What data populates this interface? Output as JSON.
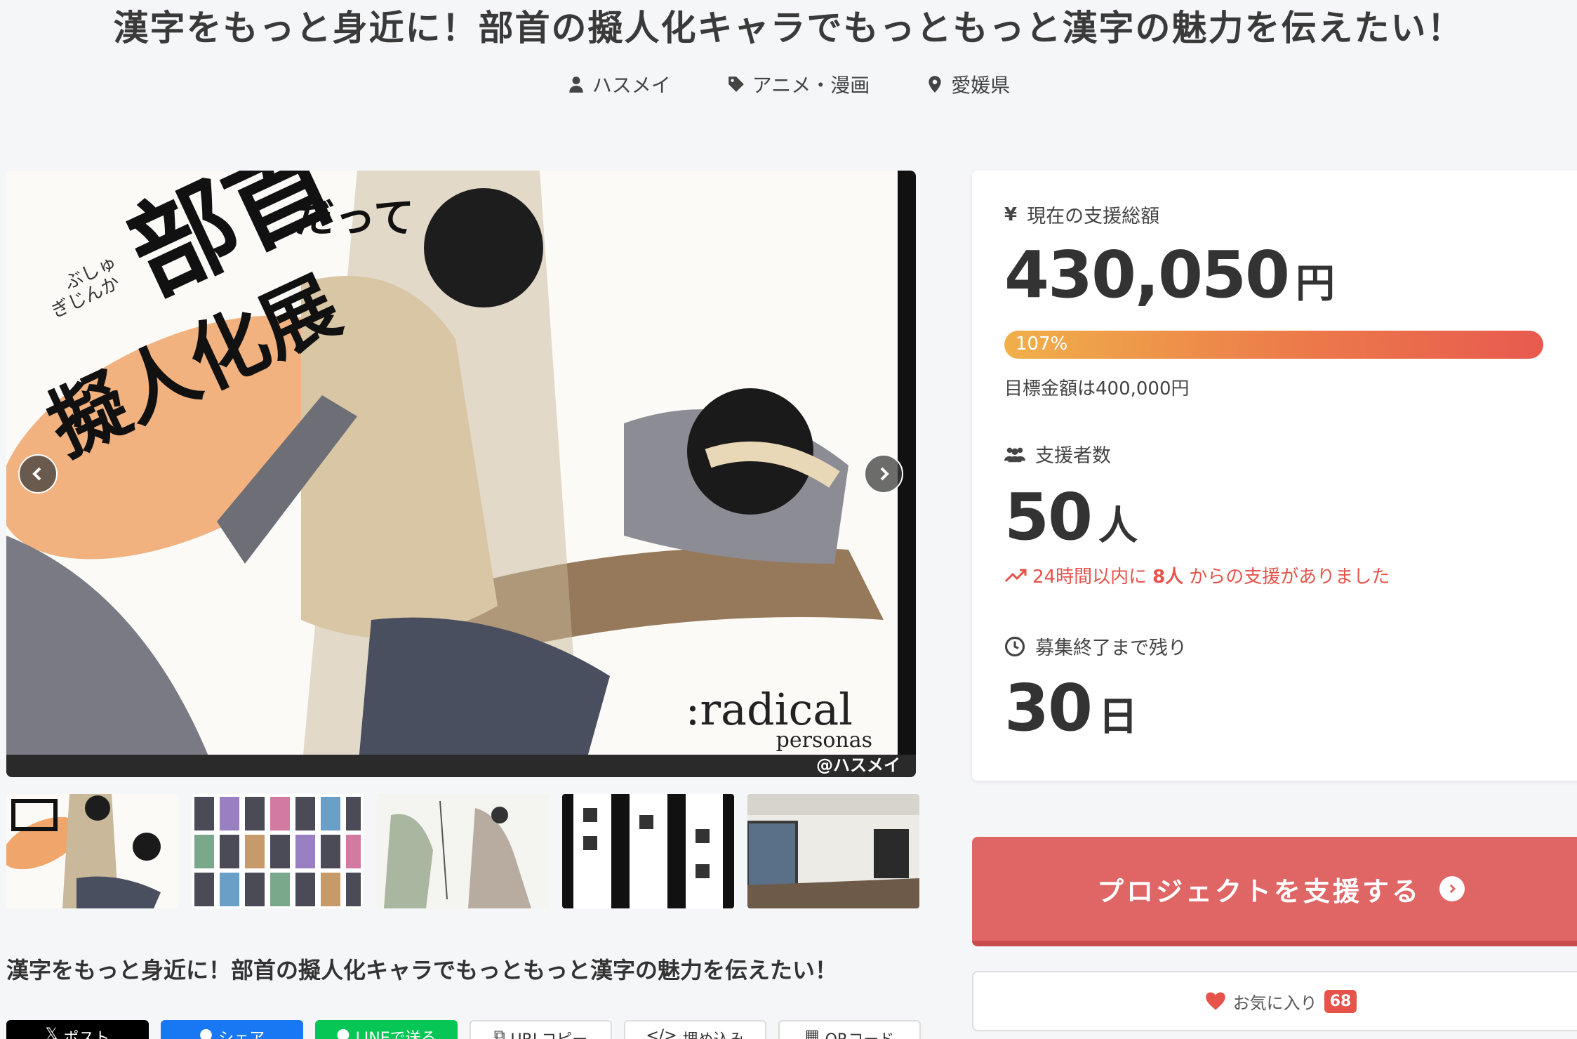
{
  "project": {
    "title": "漢字をもっと身近に！部首の擬人化キャラでもっともっと漢字の魅力を伝えたい！",
    "author": "ハスメイ",
    "category": "アニメ・漫画",
    "location": "愛媛県"
  },
  "hero": {
    "brand": ":radical",
    "brand_sub": "personas",
    "credit": "@ハスメイ",
    "heading_small": "だって",
    "heading_big": "部首",
    "heading_line2": "擬人化展",
    "ruby_1": "ぶしゅ",
    "ruby_2": "ぎじんか"
  },
  "subtitle": "漢字をもっと身近に！部首の擬人化キャラでもっともっと漢字の魅力を伝えたい！",
  "share": {
    "x": "ポスト",
    "facebook": "シェア",
    "line": "LINEで送る",
    "url_copy": "URLコピー",
    "embed": "埋め込み",
    "qr": "QRコード"
  },
  "stats": {
    "amount_label": "現在の支援総額",
    "amount": "430,050",
    "amount_unit": "円",
    "progress_percent": 107,
    "progress_text": "107%",
    "goal": "目標金額は400,000円",
    "backers_label": "支援者数",
    "backers": "50",
    "backers_unit": "人",
    "recent_prefix": "24時間以内に",
    "recent_count": "8人",
    "recent_suffix": "からの支援がありました",
    "remaining_label": "募集終了まで残り",
    "remaining": "30",
    "remaining_unit": "日"
  },
  "actions": {
    "support": "プロジェクトを支援する",
    "favorite": "お気に入り",
    "favorite_count": "68"
  },
  "colors": {
    "accent": "#e06565",
    "progress_start": "#f0b04a",
    "progress_end": "#e85a4f",
    "alert": "#e5534b"
  }
}
